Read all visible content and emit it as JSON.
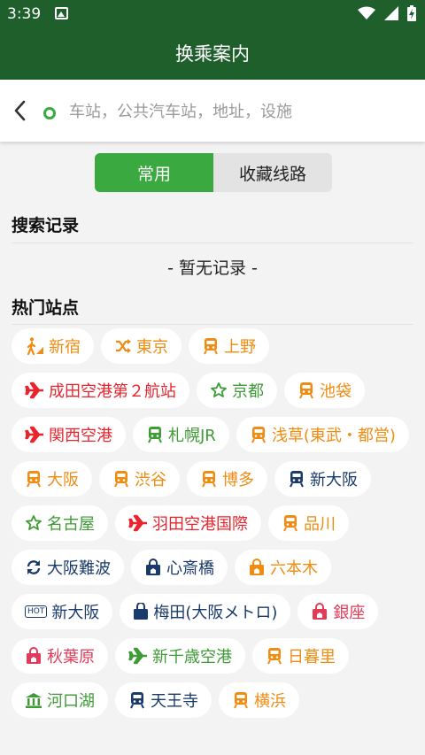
{
  "status_bar": {
    "time": "3:39"
  },
  "app_bar": {
    "title": "换乘案内"
  },
  "search": {
    "placeholder": "车站，公共汽车站，地址，设施",
    "value": ""
  },
  "segment": {
    "tabs": [
      "常用",
      "收藏线路"
    ],
    "active": 0
  },
  "history": {
    "title": "搜索记录",
    "empty_text": "- 暂无记录 -"
  },
  "popular": {
    "title": "热门站点",
    "stations": [
      {
        "label": "新宿",
        "icon": "walk-icon",
        "color": "orange"
      },
      {
        "label": "東京",
        "icon": "shuffle-icon",
        "color": "orange"
      },
      {
        "label": "上野",
        "icon": "train-icon",
        "color": "orange"
      },
      {
        "label": "成田空港第２航站",
        "icon": "plane-icon",
        "color": "red"
      },
      {
        "label": "京都",
        "icon": "star-icon",
        "color": "green"
      },
      {
        "label": "池袋",
        "icon": "train-icon",
        "color": "orange"
      },
      {
        "label": "関西空港",
        "icon": "plane-icon",
        "color": "red"
      },
      {
        "label": "札幌JR",
        "icon": "train-icon",
        "color": "green"
      },
      {
        "label": "浅草(東武・都営)",
        "icon": "train-icon",
        "color": "orange"
      },
      {
        "label": "大阪",
        "icon": "train-icon",
        "color": "orange"
      },
      {
        "label": "渋谷",
        "icon": "train-icon",
        "color": "orange"
      },
      {
        "label": "博多",
        "icon": "train-icon",
        "color": "orange"
      },
      {
        "label": "新大阪",
        "icon": "train-icon",
        "color": "navy"
      },
      {
        "label": "名古屋",
        "icon": "star-icon",
        "color": "green"
      },
      {
        "label": "羽田空港国際",
        "icon": "plane-icon",
        "color": "red"
      },
      {
        "label": "品川",
        "icon": "train-icon",
        "color": "orange"
      },
      {
        "label": "大阪難波",
        "icon": "refresh-icon",
        "color": "navy"
      },
      {
        "label": "心斎橋",
        "icon": "shop-icon",
        "color": "navy"
      },
      {
        "label": "六本木",
        "icon": "shop-icon",
        "color": "orange"
      },
      {
        "label": "新大阪",
        "icon": "hot-icon",
        "color": "navy"
      },
      {
        "label": "梅田(大阪メトロ)",
        "icon": "bag-icon",
        "color": "navy"
      },
      {
        "label": "銀座",
        "icon": "shop-icon",
        "color": "pink"
      },
      {
        "label": "秋葉原",
        "icon": "shop-icon",
        "color": "pink"
      },
      {
        "label": "新千歳空港",
        "icon": "plane-icon",
        "color": "green"
      },
      {
        "label": "日暮里",
        "icon": "train-icon",
        "color": "orange"
      },
      {
        "label": "河口湖",
        "icon": "temple-icon",
        "color": "green"
      },
      {
        "label": "天王寺",
        "icon": "train-icon",
        "color": "navy"
      },
      {
        "label": "横浜",
        "icon": "train-icon",
        "color": "orange"
      }
    ]
  },
  "colors": {
    "header": "#1e5f2c",
    "accent": "#3aa93f",
    "orange": "#f08c12",
    "red": "#e8252e",
    "green": "#3e9b36",
    "navy": "#1a3a6b",
    "pink": "#e23b5a"
  }
}
